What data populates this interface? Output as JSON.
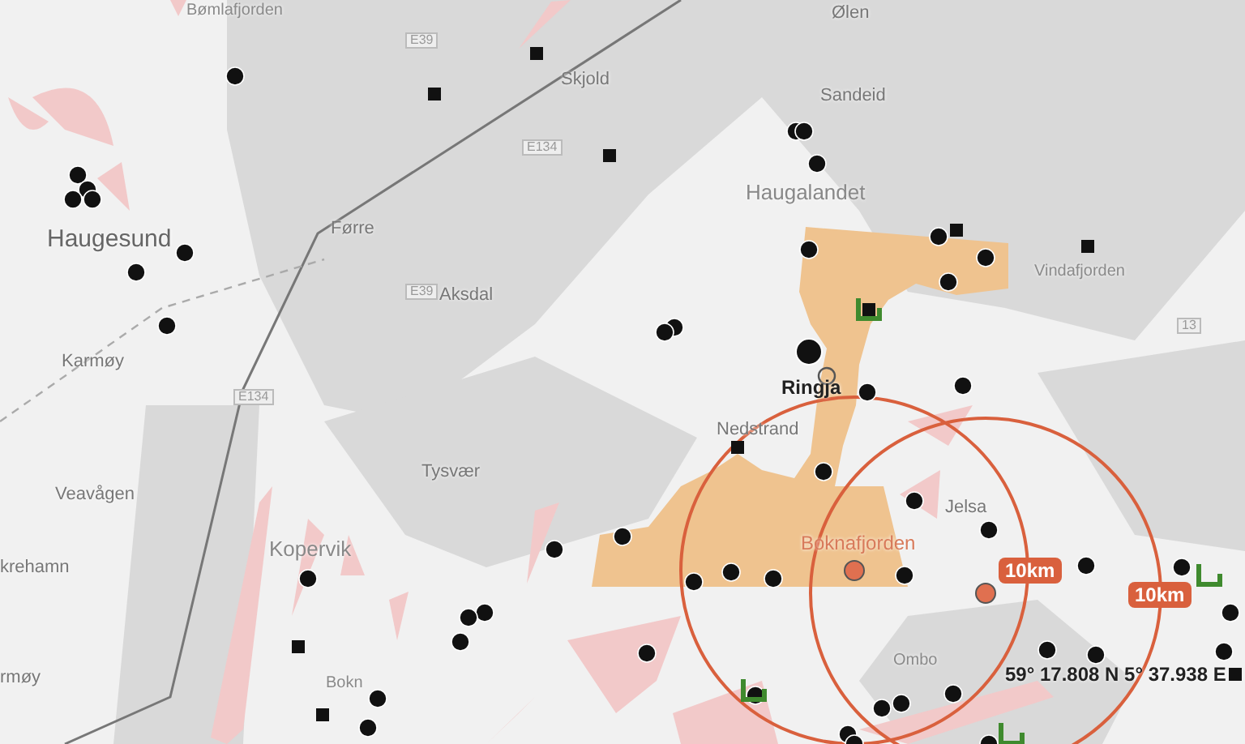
{
  "map": {
    "place_labels": [
      {
        "text": "Bømlafjorden",
        "kind": "water"
      },
      {
        "text": "Skjold",
        "kind": "place"
      },
      {
        "text": "Ølen",
        "kind": "place"
      },
      {
        "text": "Sandeid",
        "kind": "place"
      },
      {
        "text": "Haugesund",
        "kind": "city"
      },
      {
        "text": "Haugalandet",
        "kind": "region"
      },
      {
        "text": "Førre",
        "kind": "place"
      },
      {
        "text": "Aksdal",
        "kind": "place"
      },
      {
        "text": "Vindafjorden",
        "kind": "water"
      },
      {
        "text": "Karmøy",
        "kind": "place"
      },
      {
        "text": "Tysvær",
        "kind": "place"
      },
      {
        "text": "Veavågen",
        "kind": "place"
      },
      {
        "text": "Kopervik",
        "kind": "region"
      },
      {
        "text": "krehamn",
        "kind": "place"
      },
      {
        "text": "Ringja",
        "kind": "selected"
      },
      {
        "text": "Nedstrand",
        "kind": "place"
      },
      {
        "text": "Jelsa",
        "kind": "place"
      },
      {
        "text": "Boknafjorden",
        "kind": "target"
      },
      {
        "text": "Bokn",
        "kind": "water"
      },
      {
        "text": "Ombo",
        "kind": "water"
      },
      {
        "text": "rmøy",
        "kind": "place"
      }
    ],
    "road_shields": [
      "E39",
      "E39",
      "E134",
      "E134",
      "13"
    ],
    "range_rings": [
      {
        "label": "10km"
      },
      {
        "label": "10km"
      }
    ],
    "coordinates": "59° 17.808 N 5° 37.938 E"
  }
}
